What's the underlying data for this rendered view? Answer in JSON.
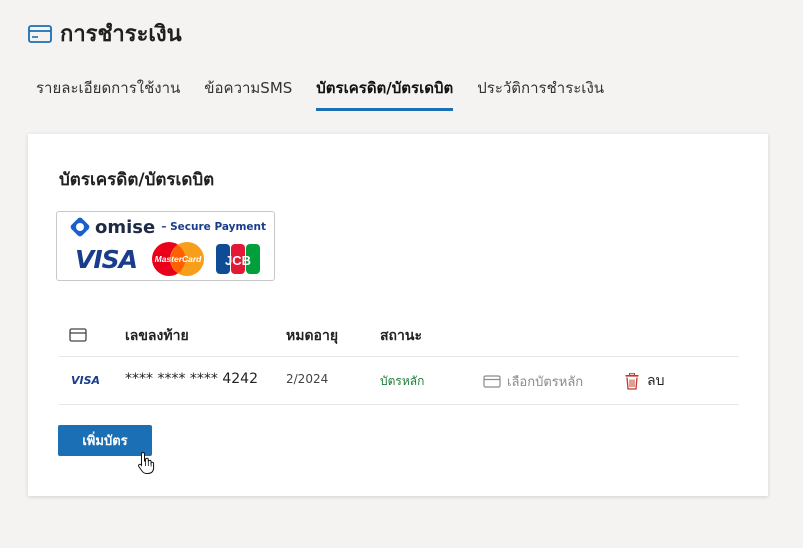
{
  "header": {
    "title": "การชำระเงิน",
    "icon": "credit-card-icon"
  },
  "tabs": [
    {
      "label": "รายละเอียดการใช้งาน",
      "active": false
    },
    {
      "label": "ข้อความSMS",
      "active": false
    },
    {
      "label": "บัตรเครดิต/บัตรเดบิต",
      "active": true
    },
    {
      "label": "ประวัติการชำระเงิน",
      "active": false
    }
  ],
  "section": {
    "title": "บัตรเครดิต/บัตรเดบิต"
  },
  "payment_logo": {
    "brand": "omise",
    "tagline": "– Secure Payment",
    "visa": "VISA",
    "mastercard": "MasterCard",
    "jcb": "JCB"
  },
  "table": {
    "headers": {
      "icon": "credit-card-icon",
      "last_digits": "เลขลงท้าย",
      "expiry": "หมดอายุ",
      "status": "สถานะ"
    },
    "rows": [
      {
        "brand": "VISA",
        "number": "**** **** **** 4242",
        "expiry": "2/2024",
        "status": "บัตรหลัก",
        "set_primary_label": "เลือกบัตรหลัก",
        "delete_label": "ลบ"
      }
    ]
  },
  "add_button": {
    "label": "เพิ่มบัตร"
  },
  "colors": {
    "accent": "#1a6fb5",
    "status_primary": "#1e7d33",
    "delete_icon": "#c0392b"
  }
}
